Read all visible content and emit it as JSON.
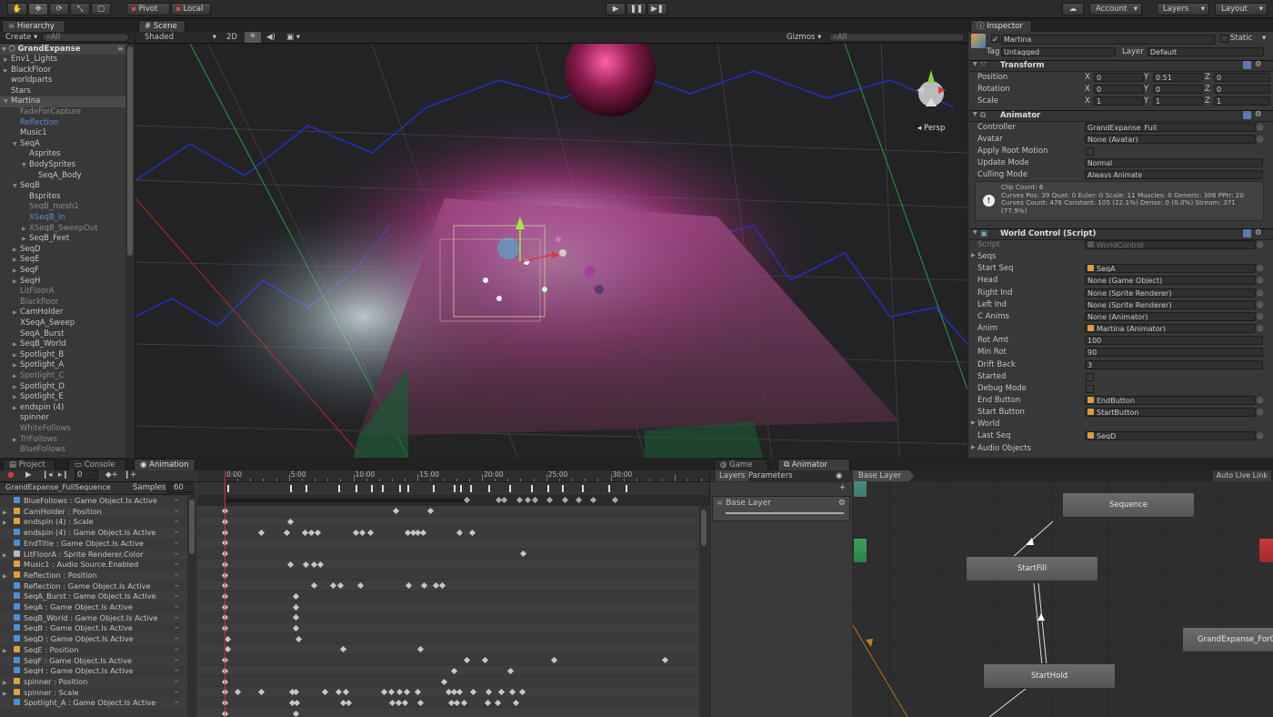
{
  "toolbar": {
    "pivot": "Pivot",
    "local": "Local",
    "account": "Account",
    "layers": "Layers",
    "layout": "Layout"
  },
  "hierarchy": {
    "tab": "Hierarchy",
    "create": "Create",
    "search_placeholder": "All",
    "scene_name": "GrandExpanse",
    "items": [
      {
        "label": "Env1_Lights",
        "indent": 1,
        "fold": true,
        "style": "normal"
      },
      {
        "label": "BlackFloor",
        "indent": 1,
        "fold": true,
        "style": "normal"
      },
      {
        "label": "worldparts",
        "indent": 1,
        "fold": false,
        "style": "normal"
      },
      {
        "label": "Stars",
        "indent": 1,
        "fold": false,
        "style": "normal"
      },
      {
        "label": "Martina",
        "indent": 1,
        "fold": "open",
        "style": "selected"
      },
      {
        "label": "FadeForCapture",
        "indent": 2,
        "fold": false,
        "style": "muted"
      },
      {
        "label": "Reflection",
        "indent": 2,
        "fold": false,
        "style": "blue"
      },
      {
        "label": "Music1",
        "indent": 2,
        "fold": false,
        "style": "normal"
      },
      {
        "label": "SeqA",
        "indent": 2,
        "fold": "open",
        "style": "normal"
      },
      {
        "label": "Asprites",
        "indent": 3,
        "fold": false,
        "style": "normal"
      },
      {
        "label": "BodySprites",
        "indent": 3,
        "fold": "open",
        "style": "normal"
      },
      {
        "label": "SeqA_Body",
        "indent": 4,
        "fold": false,
        "style": "normal"
      },
      {
        "label": "SeqB",
        "indent": 2,
        "fold": "open",
        "style": "normal"
      },
      {
        "label": "Bsprites",
        "indent": 3,
        "fold": false,
        "style": "normal"
      },
      {
        "label": "SeqB_mesh1",
        "indent": 3,
        "fold": false,
        "style": "muted"
      },
      {
        "label": "XSeqB_In",
        "indent": 3,
        "fold": false,
        "style": "blue"
      },
      {
        "label": "XSeqB_SweepOut",
        "indent": 3,
        "fold": true,
        "style": "muted"
      },
      {
        "label": "SeqB_Feet",
        "indent": 3,
        "fold": true,
        "style": "normal"
      },
      {
        "label": "SeqD",
        "indent": 2,
        "fold": true,
        "style": "normal"
      },
      {
        "label": "SeqE",
        "indent": 2,
        "fold": true,
        "style": "normal"
      },
      {
        "label": "SeqF",
        "indent": 2,
        "fold": true,
        "style": "normal"
      },
      {
        "label": "SeqH",
        "indent": 2,
        "fold": true,
        "style": "normal"
      },
      {
        "label": "LitFloorA",
        "indent": 2,
        "fold": false,
        "style": "muted"
      },
      {
        "label": "Blackfloor",
        "indent": 2,
        "fold": false,
        "style": "muted"
      },
      {
        "label": "CamHolder",
        "indent": 2,
        "fold": true,
        "style": "normal"
      },
      {
        "label": "XSeqA_Sweep",
        "indent": 2,
        "fold": false,
        "style": "normal"
      },
      {
        "label": "SeqA_Burst",
        "indent": 2,
        "fold": false,
        "style": "normal"
      },
      {
        "label": "SeqB_World",
        "indent": 2,
        "fold": true,
        "style": "normal"
      },
      {
        "label": "Spotlight_B",
        "indent": 2,
        "fold": true,
        "style": "normal"
      },
      {
        "label": "Spotlight_A",
        "indent": 2,
        "fold": true,
        "style": "normal"
      },
      {
        "label": "Spotlight_C",
        "indent": 2,
        "fold": true,
        "style": "muted"
      },
      {
        "label": "Spotlight_D",
        "indent": 2,
        "fold": true,
        "style": "normal"
      },
      {
        "label": "Spotlight_E",
        "indent": 2,
        "fold": true,
        "style": "normal"
      },
      {
        "label": "endspin (4)",
        "indent": 2,
        "fold": true,
        "style": "normal"
      },
      {
        "label": "spinner",
        "indent": 2,
        "fold": false,
        "style": "normal"
      },
      {
        "label": "WhiteFollows",
        "indent": 2,
        "fold": false,
        "style": "muted"
      },
      {
        "label": "TriFollows",
        "indent": 2,
        "fold": true,
        "style": "muted"
      },
      {
        "label": "BlueFollows",
        "indent": 2,
        "fold": false,
        "style": "muted"
      }
    ]
  },
  "scene": {
    "tab": "Scene",
    "shading": "Shaded",
    "mode_2d": "2D",
    "gizmos": "Gizmos",
    "search_placeholder": "All",
    "persp": "Persp"
  },
  "inspector": {
    "tab": "Inspector",
    "object_name": "Martina",
    "static_label": "Static",
    "tag_label": "Tag",
    "tag_value": "Untagged",
    "layer_label": "Layer",
    "layer_value": "Default",
    "transform": {
      "title": "Transform",
      "rows": [
        {
          "label": "Position",
          "x": "0",
          "y": "0.51",
          "z": "0"
        },
        {
          "label": "Rotation",
          "x": "0",
          "y": "0",
          "z": "0"
        },
        {
          "label": "Scale",
          "x": "1",
          "y": "1",
          "z": "1"
        }
      ]
    },
    "animator": {
      "title": "Animator",
      "controller_label": "Controller",
      "controller_value": "GrandExpanse_Full",
      "avatar_label": "Avatar",
      "avatar_value": "None (Avatar)",
      "root_motion_label": "Apply Root Motion",
      "update_mode_label": "Update Mode",
      "update_mode_value": "Normal",
      "culling_label": "Culling Mode",
      "culling_value": "Always Animate",
      "info_lines": [
        "Clip Count: 6",
        "Curves Pos: 39 Quat: 0 Euler: 0 Scale: 11 Muscles: 0 Generic: 306 PPtr: 20",
        "Curves Count: 476 Constant: 105 (22.1%) Dense: 0 (0.0%) Stream: 371",
        "(77.9%)"
      ]
    },
    "world_control": {
      "title": "World Control (Script)",
      "rows": [
        {
          "label": "Script",
          "value": "WorldControl",
          "kind": "obj-muted"
        },
        {
          "label": "Seqs",
          "value": "",
          "kind": "fold"
        },
        {
          "label": "Start Seq",
          "value": "SeqA",
          "kind": "obj"
        },
        {
          "label": "Head",
          "value": "None (Game Object)",
          "kind": "field"
        },
        {
          "label": "Right Ind",
          "value": "None (Sprite Renderer)",
          "kind": "field"
        },
        {
          "label": "Left Ind",
          "value": "None (Sprite Renderer)",
          "kind": "field"
        },
        {
          "label": "C Anims",
          "value": "None (Animator)",
          "kind": "field"
        },
        {
          "label": "Anim",
          "value": "Martina (Animator)",
          "kind": "obj"
        },
        {
          "label": "Rot Amt",
          "value": "100",
          "kind": "num"
        },
        {
          "label": "Min Rot",
          "value": "90",
          "kind": "num"
        },
        {
          "label": "Drift Back",
          "value": "3",
          "kind": "num"
        },
        {
          "label": "Started",
          "value": "",
          "kind": "check"
        },
        {
          "label": "Debug Mode",
          "value": "",
          "kind": "check"
        },
        {
          "label": "End Button",
          "value": "EndButton",
          "kind": "obj"
        },
        {
          "label": "Start Button",
          "value": "StartButton",
          "kind": "obj"
        },
        {
          "label": "World",
          "value": "",
          "kind": "fold"
        },
        {
          "label": "Last Seq",
          "value": "SeqD",
          "kind": "obj"
        },
        {
          "label": "Audio Objects",
          "value": "",
          "kind": "fold"
        }
      ]
    }
  },
  "bottom_tabs": {
    "project": "Project",
    "console": "Console",
    "animation": "Animation",
    "game": "Game",
    "animator": "Animator"
  },
  "animation": {
    "frame": "0",
    "clip": "GrandExpanse_FullSequence",
    "samples_label": "Samples",
    "samples_value": "60",
    "ruler": [
      "0:00",
      "5:00",
      "10:00",
      "15:00",
      "20:00",
      "25:00",
      "30:00"
    ],
    "tracks": [
      {
        "label": "BlueFollows : Game Object.Is Active",
        "icon": "go",
        "fold": false,
        "keys": [
          0,
          13.3,
          16
        ]
      },
      {
        "label": "CamHolder : Position",
        "icon": "transform",
        "fold": true,
        "keys": [
          0,
          5.1
        ]
      },
      {
        "label": "endspin (4) : Scale",
        "icon": "transform",
        "fold": true,
        "keys": [
          0,
          2.8,
          4.8,
          6.2,
          6.7,
          7.2,
          10.2,
          10.7,
          11.3,
          14.2,
          14.6,
          15,
          15.4,
          18.2,
          19.2
        ]
      },
      {
        "label": "endspin (4) : Game Object.Is Active",
        "icon": "go",
        "fold": false,
        "keys": [
          0
        ]
      },
      {
        "label": "EndTitle : Game Object.Is Active",
        "icon": "go",
        "fold": false,
        "keys": [
          0,
          23.2
        ]
      },
      {
        "label": "LitFloorA : Sprite Renderer.Color",
        "icon": "sprite",
        "fold": true,
        "keys": [
          0,
          5.1,
          6.3,
          6.9,
          7.4
        ]
      },
      {
        "label": "Music1 : Audio Source.Enabled",
        "icon": "audio",
        "fold": false,
        "keys": [
          0
        ]
      },
      {
        "label": "Reflection : Position",
        "icon": "transform",
        "fold": true,
        "keys": [
          0,
          6.9,
          8.4,
          9,
          10.5,
          14.3,
          15.5,
          16.4,
          16.9
        ]
      },
      {
        "label": "Reflection : Game Object.Is Active",
        "icon": "go",
        "fold": false,
        "keys": [
          0,
          5.5
        ]
      },
      {
        "label": "SeqA_Burst : Game Object.Is Active",
        "icon": "go",
        "fold": false,
        "keys": [
          0,
          5.5
        ]
      },
      {
        "label": "SeqA : Game Object.Is Active",
        "icon": "go",
        "fold": false,
        "keys": [
          0,
          5.5
        ]
      },
      {
        "label": "SeqB_World : Game Object.Is Active",
        "icon": "go",
        "fold": false,
        "keys": [
          0,
          5.5
        ]
      },
      {
        "label": "SeqB : Game Object.Is Active",
        "icon": "go",
        "fold": false,
        "keys": [
          0.2,
          5.7
        ]
      },
      {
        "label": "SeqD : Game Object.Is Active",
        "icon": "go",
        "fold": false,
        "keys": [
          0.2,
          9.2,
          15.2
        ]
      },
      {
        "label": "SeqE : Position",
        "icon": "transform",
        "fold": true,
        "keys": [
          0,
          18.8,
          20.2,
          25.6,
          34.2
        ]
      },
      {
        "label": "SeqF : Game Object.Is Active",
        "icon": "go",
        "fold": false,
        "keys": [
          0,
          17.8,
          22.2
        ]
      },
      {
        "label": "SeqH : Game Object.Is Active",
        "icon": "go",
        "fold": false,
        "keys": [
          0,
          17
        ]
      },
      {
        "label": "spinner : Position",
        "icon": "transform",
        "fold": true,
        "keys": [
          0,
          1,
          2.8,
          5.2,
          5.5,
          7.8,
          8.8,
          9.4,
          12.4,
          12.9,
          13.6,
          14.1,
          15,
          17.4,
          17.8,
          18.2,
          19.3,
          20.5,
          21.5,
          22.3,
          23.1
        ]
      },
      {
        "label": "spinner : Scale",
        "icon": "transform",
        "fold": true,
        "keys": [
          0,
          5.2,
          5.6,
          9.2,
          9.6,
          13,
          13.5,
          14,
          15.2,
          17.6,
          18,
          18.6,
          20.4,
          21.2,
          22.6
        ]
      },
      {
        "label": "Spotlight_A : Game Object.Is Active",
        "icon": "go",
        "fold": false,
        "keys": [
          0,
          5.5
        ]
      }
    ],
    "top_keys": [
      0.2,
      5.1,
      6.3,
      8.8,
      10.2,
      11.4,
      12.2,
      13.6,
      14.2,
      16.2,
      17.8,
      18.3,
      19.1,
      20.5,
      22.1,
      23.8,
      25.1,
      26.2,
      27.8,
      29.8,
      31.2
    ],
    "summary_keys": [
      18.8,
      21.3,
      21.7,
      22.9,
      23.5,
      24.1,
      25.2,
      26.4,
      27.5,
      28.6,
      30.3
    ]
  },
  "animator": {
    "layers_tab": "Layers",
    "parameters_tab": "Parameters",
    "breadcrumb": "Base Layer",
    "auto_live": "Auto Live Link",
    "layer_name": "Base Layer",
    "states": [
      "Sequence",
      "StartFill",
      "StartHold",
      "GrandExpanse_ForC"
    ]
  },
  "colors": {
    "panel": "#383838",
    "dark": "#282828",
    "selection": "#3e5f96",
    "keyframe": "#c8c8c8",
    "playhead": "#d33030"
  }
}
